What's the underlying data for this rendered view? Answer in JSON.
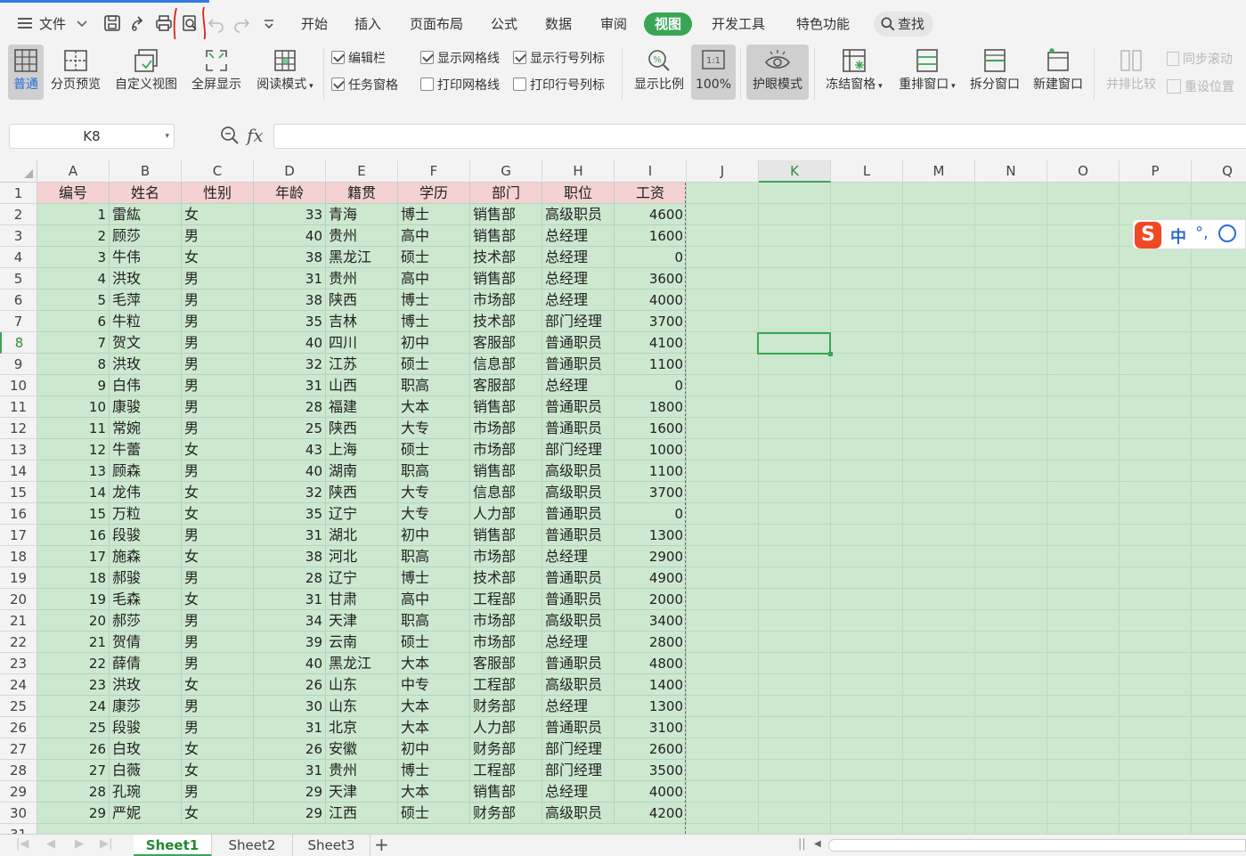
{
  "menu": {
    "file_label": "文件",
    "tabs": [
      "开始",
      "插入",
      "页面布局",
      "公式",
      "数据",
      "审阅",
      "视图",
      "开发工具",
      "特色功能"
    ],
    "active_tab": "视图",
    "search_label": "查找"
  },
  "ribbon": {
    "normal": "普通",
    "page_preview": "分页预览",
    "custom_view": "自定义视图",
    "full_screen": "全屏显示",
    "read_mode": "阅读模式",
    "cb_formula_bar": "编辑栏",
    "cb_task_pane": "任务窗格",
    "cb_show_grid": "显示网格线",
    "cb_print_grid": "打印网格线",
    "cb_show_headers": "显示行号列标",
    "cb_print_headers": "打印行号列标",
    "zoom": "显示比例",
    "zoom_100": "100%",
    "eye_mode": "护眼模式",
    "freeze": "冻结窗格",
    "rearrange": "重排窗口",
    "split": "拆分窗口",
    "new_window": "新建窗口",
    "side_by_side": "并排比较",
    "sync_scroll": "同步滚动",
    "reset_pos": "重设位置"
  },
  "formula": {
    "name_box": "K8",
    "fx": "fx",
    "value": ""
  },
  "grid": {
    "columns": [
      "A",
      "B",
      "C",
      "D",
      "E",
      "F",
      "G",
      "H",
      "I",
      "J",
      "K",
      "L",
      "M",
      "N",
      "O",
      "P",
      "Q"
    ],
    "selected_column": "K",
    "selected_row": 8,
    "headers": [
      "编号",
      "姓名",
      "性别",
      "年龄",
      "籍贯",
      "学历",
      "部门",
      "职位",
      "工资"
    ],
    "rows": [
      [
        "1",
        "雷紘",
        "女",
        "33",
        "青海",
        "博士",
        "销售部",
        "高级职员",
        "4600"
      ],
      [
        "2",
        "顾莎",
        "男",
        "40",
        "贵州",
        "高中",
        "销售部",
        "总经理",
        "1600"
      ],
      [
        "3",
        "牛伟",
        "女",
        "38",
        "黑龙江",
        "硕士",
        "技术部",
        "总经理",
        "0"
      ],
      [
        "4",
        "洪玫",
        "男",
        "31",
        "贵州",
        "高中",
        "销售部",
        "总经理",
        "3600"
      ],
      [
        "5",
        "毛萍",
        "男",
        "38",
        "陕西",
        "博士",
        "市场部",
        "总经理",
        "4000"
      ],
      [
        "6",
        "牛粒",
        "男",
        "35",
        "吉林",
        "博士",
        "技术部",
        "部门经理",
        "3700"
      ],
      [
        "7",
        "贺文",
        "男",
        "40",
        "四川",
        "初中",
        "客服部",
        "普通职员",
        "4100"
      ],
      [
        "8",
        "洪玫",
        "男",
        "32",
        "江苏",
        "硕士",
        "信息部",
        "普通职员",
        "1100"
      ],
      [
        "9",
        "白伟",
        "男",
        "31",
        "山西",
        "职高",
        "客服部",
        "总经理",
        "0"
      ],
      [
        "10",
        "康骏",
        "男",
        "28",
        "福建",
        "大本",
        "销售部",
        "普通职员",
        "1800"
      ],
      [
        "11",
        "常婉",
        "男",
        "25",
        "陕西",
        "大专",
        "市场部",
        "普通职员",
        "1600"
      ],
      [
        "12",
        "牛蕾",
        "女",
        "43",
        "上海",
        "硕士",
        "市场部",
        "部门经理",
        "1000"
      ],
      [
        "13",
        "顾森",
        "男",
        "40",
        "湖南",
        "职高",
        "销售部",
        "高级职员",
        "1100"
      ],
      [
        "14",
        "龙伟",
        "女",
        "32",
        "陕西",
        "大专",
        "信息部",
        "高级职员",
        "3700"
      ],
      [
        "15",
        "万粒",
        "女",
        "35",
        "辽宁",
        "大专",
        "人力部",
        "普通职员",
        "0"
      ],
      [
        "16",
        "段骏",
        "男",
        "31",
        "湖北",
        "初中",
        "销售部",
        "普通职员",
        "1300"
      ],
      [
        "17",
        "施森",
        "女",
        "38",
        "河北",
        "职高",
        "市场部",
        "总经理",
        "2900"
      ],
      [
        "18",
        "郝骏",
        "男",
        "28",
        "辽宁",
        "博士",
        "技术部",
        "普通职员",
        "4900"
      ],
      [
        "19",
        "毛森",
        "女",
        "31",
        "甘肃",
        "高中",
        "工程部",
        "普通职员",
        "2000"
      ],
      [
        "20",
        "郝莎",
        "男",
        "34",
        "天津",
        "职高",
        "市场部",
        "高级职员",
        "3400"
      ],
      [
        "21",
        "贺倩",
        "男",
        "39",
        "云南",
        "硕士",
        "市场部",
        "总经理",
        "2800"
      ],
      [
        "22",
        "薛倩",
        "男",
        "40",
        "黑龙江",
        "大本",
        "客服部",
        "普通职员",
        "4800"
      ],
      [
        "23",
        "洪玫",
        "女",
        "26",
        "山东",
        "中专",
        "工程部",
        "高级职员",
        "1400"
      ],
      [
        "24",
        "康莎",
        "男",
        "30",
        "山东",
        "大本",
        "财务部",
        "总经理",
        "1300"
      ],
      [
        "25",
        "段骏",
        "男",
        "31",
        "北京",
        "大本",
        "人力部",
        "普通职员",
        "3100"
      ],
      [
        "26",
        "白玫",
        "女",
        "26",
        "安徽",
        "初中",
        "财务部",
        "部门经理",
        "2600"
      ],
      [
        "27",
        "白薇",
        "女",
        "31",
        "贵州",
        "博士",
        "工程部",
        "部门经理",
        "3500"
      ],
      [
        "28",
        "孔琬",
        "男",
        "29",
        "天津",
        "大本",
        "销售部",
        "总经理",
        "4000"
      ],
      [
        "29",
        "严妮",
        "女",
        "29",
        "江西",
        "硕士",
        "财务部",
        "高级职员",
        "4200"
      ]
    ]
  },
  "ime": {
    "logo": "S",
    "mode": "中",
    "punct": "°,"
  },
  "sheets": {
    "tabs": [
      "Sheet1",
      "Sheet2",
      "Sheet3"
    ],
    "active": "Sheet1",
    "add": "+"
  },
  "colors": {
    "accent": "#3aa655",
    "eye_mode_bg": "#cce8cf",
    "header_row_bg": "#f4d2d2"
  }
}
